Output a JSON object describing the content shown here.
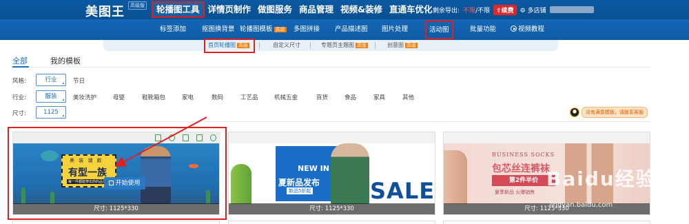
{
  "app": {
    "logo": "美图王",
    "logo_badge": "高级版"
  },
  "main_nav": [
    {
      "label": "轮播图工具",
      "active": true
    },
    {
      "label": "详情页制作"
    },
    {
      "label": "做图服务"
    },
    {
      "label": "商品管理"
    },
    {
      "label": "视频&装修"
    },
    {
      "label": "直通车优化"
    }
  ],
  "account": {
    "export_label": "剩余导出:",
    "export_value": "不限",
    "export_suffix": "/不限",
    "renew_label": "续费",
    "shop_label": "多店铺"
  },
  "sub_nav": [
    {
      "label": "标签添加"
    },
    {
      "label": "抠图换背景"
    },
    {
      "label": "轮播图模板",
      "badge": "高级"
    },
    {
      "label": "多图拼接"
    },
    {
      "label": "产品描述图"
    },
    {
      "label": "图片处理"
    },
    {
      "label": "活动图",
      "highlighted": true
    },
    {
      "label": "批量功能"
    },
    {
      "label": "视频教程"
    }
  ],
  "categories": [
    {
      "label": "首页轮播图",
      "badge": "高级",
      "active": true
    },
    {
      "label": "自定义尺寸"
    },
    {
      "label": "专题页主题图",
      "badge": "高级"
    },
    {
      "label": "创意图",
      "badge": "高级"
    }
  ],
  "tabs": [
    {
      "label": "全部",
      "active": true
    },
    {
      "label": "我的模板"
    }
  ],
  "filters": {
    "style": {
      "label": "风格:",
      "selected": "行业",
      "options": [
        "节日"
      ]
    },
    "industry": {
      "label": "行业:",
      "selected": "服装",
      "options": [
        "美妆洗护",
        "母婴",
        "鞋靴箱包",
        "家电",
        "数码",
        "工艺品",
        "机械五金",
        "百货",
        "食品",
        "家具",
        "其他"
      ]
    },
    "size": {
      "label": "尺寸:",
      "selected": "1125"
    }
  },
  "qq_help": "没有满意模板，请联系客服",
  "templates": [
    {
      "size": "尺寸: 1125*330",
      "start_label": "开始使用",
      "texts": {
        "top": "美 装 潮 款",
        "title": "有型一族",
        "sub": "每一件都能穿出你的品位"
      }
    },
    {
      "size": "尺寸: 1125*330",
      "texts": {
        "newin": "NEW IN",
        "title": "夏新品发布",
        "sub": "新品5折起",
        "sale": "SALE"
      }
    },
    {
      "size": "尺寸: 1125*330",
      "texts": {
        "top": "BUSINESS    SOCKS",
        "title": "包芯丝连裤袜",
        "badge": "第2件半价",
        "desc": "夏季新品 火爆销售"
      }
    }
  ],
  "watermark": {
    "brand": "Baidu经验",
    "url": "jingyan.baidu.com"
  },
  "colors": {
    "primary": "#1d6fc3",
    "topbar": "#0b5aa3",
    "highlight": "#e02020",
    "badge": "#ff7a00"
  }
}
